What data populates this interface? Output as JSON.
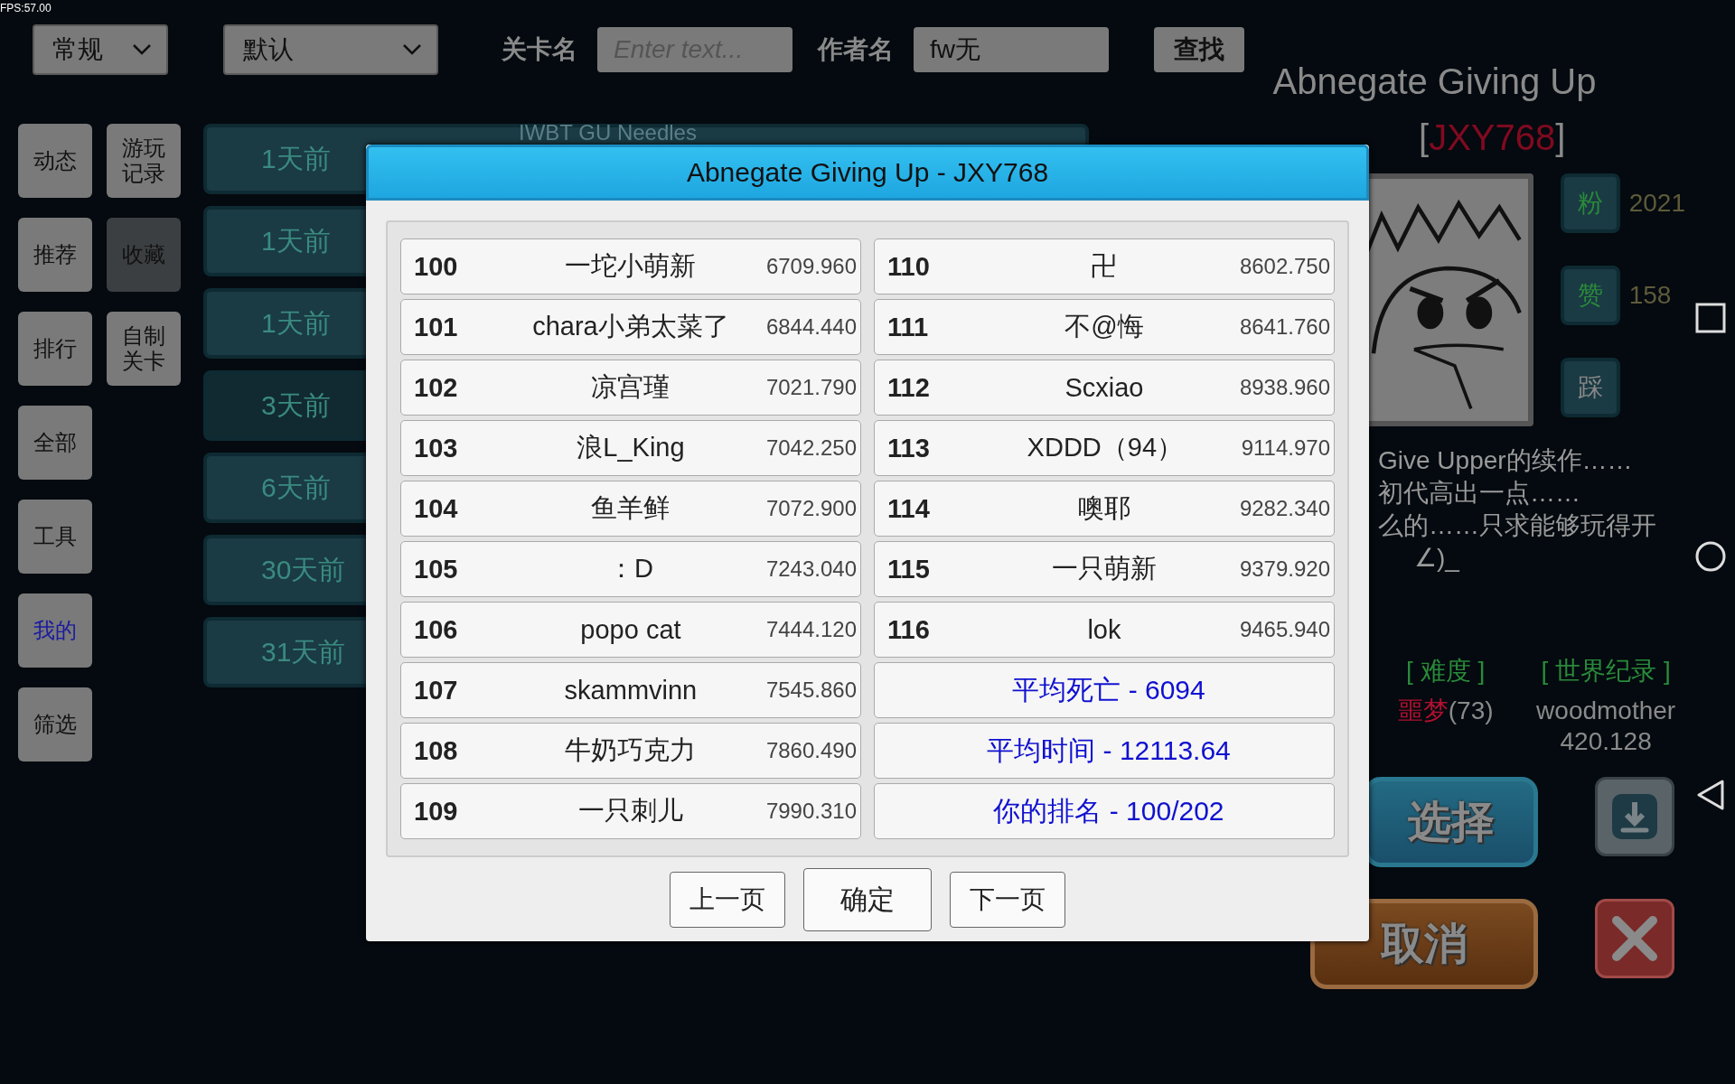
{
  "fps": "FPS:57.00",
  "top_bar": {
    "dropdowns": [
      {
        "value": "常规"
      },
      {
        "value": "默认"
      }
    ],
    "fields": [
      {
        "label": "关卡名",
        "placeholder": "Enter text..."
      },
      {
        "label": "作者名",
        "value": "fw无"
      }
    ],
    "search_button": "查找"
  },
  "sidebar": {
    "columns": [
      [
        {
          "label": "动态",
          "selected": false,
          "on": false
        },
        {
          "label": "推荐",
          "selected": false,
          "on": false
        },
        {
          "label": "排行",
          "selected": false,
          "on": false
        },
        {
          "label": "全部",
          "selected": false,
          "on": false
        },
        {
          "label": "工具",
          "selected": false,
          "on": false
        },
        {
          "label": "我的",
          "selected": false,
          "on": true
        },
        {
          "label": "筛选",
          "selected": false,
          "on": false
        }
      ],
      [
        {
          "label": "游玩记录",
          "selected": false,
          "on": false
        },
        {
          "label": "收藏",
          "selected": true,
          "on": false
        },
        {
          "label": "自制关卡",
          "selected": false,
          "on": false
        }
      ]
    ]
  },
  "level_list": [
    {
      "title": "IWBT GU Needles",
      "date": "1天前",
      "selected": false
    },
    {
      "date": "1天前",
      "selected": false
    },
    {
      "date": "1天前",
      "selected": false
    },
    {
      "date": "3天前",
      "selected": true
    },
    {
      "date": "6天前",
      "selected": false
    },
    {
      "date": "30天前",
      "selected": false
    },
    {
      "date": "31天前",
      "selected": false
    }
  ],
  "detail": {
    "title": "Abnegate Giving Up",
    "author_open": "[",
    "author": "JXY768",
    "author_close": "]",
    "stats": [
      {
        "label": "粉",
        "value": "2021"
      },
      {
        "label": "赞",
        "value": "158"
      },
      {
        "label": "踩"
      }
    ],
    "description": [
      "Give Upper的续作……",
      "初代高出一点……",
      "么的……只求能够玩得开",
      "∠)_"
    ],
    "difficulty_header": "[ 难度 ]",
    "difficulty": "噩梦",
    "difficulty_score": "(73)",
    "record_header": "[ 世界纪录 ]",
    "record_holder": "woodmother",
    "record_time": "420.128",
    "select_button": "选择",
    "cancel_button": "取消"
  },
  "dialog": {
    "title": "Abnegate Giving Up - JXY768",
    "entries": [
      {
        "rank": "100",
        "name": "一坨小萌新",
        "score": "6709.960"
      },
      {
        "rank": "101",
        "name": "chara小弟太菜了",
        "score": "6844.440"
      },
      {
        "rank": "102",
        "name": "凉宫瑾",
        "score": "7021.790"
      },
      {
        "rank": "103",
        "name": "浪L_King",
        "score": "7042.250"
      },
      {
        "rank": "104",
        "name": "鱼羊鲜",
        "score": "7072.900"
      },
      {
        "rank": "105",
        "name": "：D",
        "score": "7243.040"
      },
      {
        "rank": "106",
        "name": "popo cat",
        "score": "7444.120"
      },
      {
        "rank": "107",
        "name": "skammvinn",
        "score": "7545.860"
      },
      {
        "rank": "108",
        "name": "牛奶巧克力",
        "score": "7860.490"
      },
      {
        "rank": "109",
        "name": "一只刺儿",
        "score": "7990.310"
      },
      {
        "rank": "110",
        "name": "卍",
        "score": "8602.750"
      },
      {
        "rank": "111",
        "name": "不@悔",
        "score": "8641.760"
      },
      {
        "rank": "112",
        "name": "Scxiao",
        "score": "8938.960"
      },
      {
        "rank": "113",
        "name": "XDDD（94）",
        "score": "9114.970"
      },
      {
        "rank": "114",
        "name": "噢耶",
        "score": "9282.340"
      },
      {
        "rank": "115",
        "name": "一只萌新",
        "score": "9379.920"
      },
      {
        "rank": "116",
        "name": "lok",
        "score": "9465.940"
      }
    ],
    "summary": [
      "平均死亡 - 6094",
      "平均时间 - 12113.64",
      "你的排名 - 100/202"
    ],
    "buttons": [
      {
        "label": "上一页",
        "kind": "nav"
      },
      {
        "label": "确定",
        "kind": "primary"
      },
      {
        "label": "下一页",
        "kind": "nav"
      }
    ]
  }
}
